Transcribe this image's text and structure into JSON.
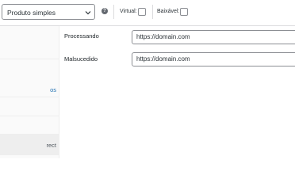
{
  "header": {
    "product_type": "Produto simples",
    "help_icon": "question-circle-icon",
    "virtual_label": "Virtual:",
    "downloadable_label": "Baixável:"
  },
  "tabs": [
    {
      "label": ""
    },
    {
      "label": "os"
    },
    {
      "label": ""
    },
    {
      "label": "rect"
    }
  ],
  "fields": [
    {
      "label": "Processando",
      "value": "https://domain.com"
    },
    {
      "label": "Malsucedido",
      "value": "https://domain.com"
    }
  ],
  "colors": {
    "link": "#2271b1",
    "border": "#8c8f94",
    "active_tab_bg": "#eeeeee"
  }
}
